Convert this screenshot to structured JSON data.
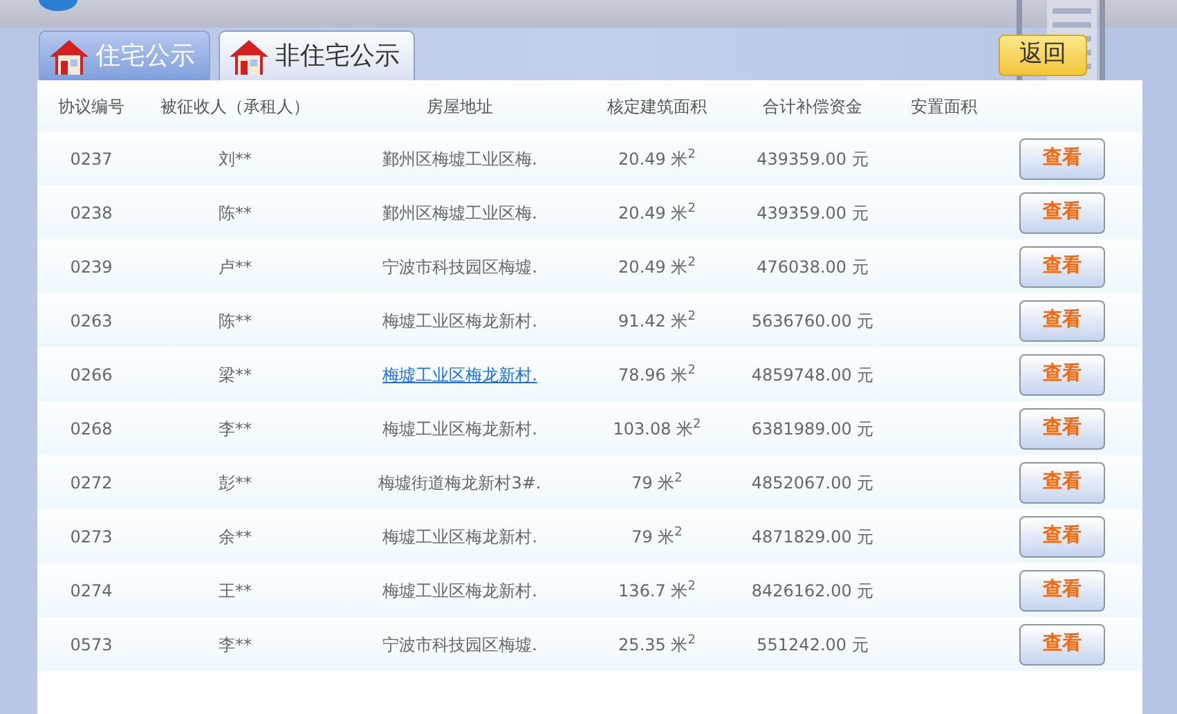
{
  "tabs": [
    {
      "label": "住宅公示",
      "selected": true
    },
    {
      "label": "非住宅公示",
      "selected": false
    }
  ],
  "back_button": "返回",
  "table": {
    "columns": [
      "协议编号",
      "被征收人（承租人）",
      "房屋地址",
      "核定建筑面积",
      "合计补偿资金",
      "安置面积"
    ],
    "rows": [
      {
        "number": "0237",
        "name": "刘**",
        "address": "鄞州区梅墟工业区梅.",
        "area": "20.49 米$^{2}$",
        "amount": "439359.00 元",
        "hovered": false,
        "action": "查看"
      },
      {
        "number": "0238",
        "name": "陈**",
        "address": "鄞州区梅墟工业区梅.",
        "area": "20.49 米$^{2}$",
        "amount": "439359.00 元",
        "hovered": false,
        "action": "查看"
      },
      {
        "number": "0239",
        "name": "卢**",
        "address": "宁波市科技园区梅墟.",
        "area": "20.49 米$^{2}$",
        "amount": "476038.00 元",
        "hovered": false,
        "action": "查看"
      },
      {
        "number": "0263",
        "name": "陈**",
        "address": "梅墟工业区梅龙新村.",
        "area": "91.42 米$^{2}$",
        "amount": "5636760.00 元",
        "hovered": false,
        "action": "查看"
      },
      {
        "number": "0266",
        "name": "梁**",
        "address": "梅墟工业区梅龙新村.",
        "area": "78.96 米$^{2}$",
        "amount": "4859748.00 元",
        "hovered": true,
        "action": "查看"
      },
      {
        "number": "0268",
        "name": "李**",
        "address": "梅墟工业区梅龙新村.",
        "area": "103.08 米$^{2}$",
        "amount": "6381989.00 元",
        "hovered": false,
        "action": "查看"
      },
      {
        "number": "0272",
        "name": "彭**",
        "address": "梅墟街道梅龙新村3#.",
        "area": "79 米$^{2}$",
        "amount": "4852067.00 元",
        "hovered": false,
        "action": "查看"
      },
      {
        "number": "0273",
        "name": "余**",
        "address": "梅墟工业区梅龙新村.",
        "area": "79 米$^{2}$",
        "amount": "4871829.00 元",
        "hovered": false,
        "action": "查看"
      },
      {
        "number": "0274",
        "name": "王**",
        "address": "梅墟工业区梅龙新村.",
        "area": "136.7 米$^{2}$",
        "amount": "8426162.00 元",
        "hovered": false,
        "action": "查看"
      },
      {
        "number": "0573",
        "name": "李**",
        "address": "宁波市科技园区梅墟.",
        "area": "25.35 米$^{2}$",
        "amount": "551242.00 元",
        "hovered": false,
        "action": "查看"
      }
    ]
  }
}
